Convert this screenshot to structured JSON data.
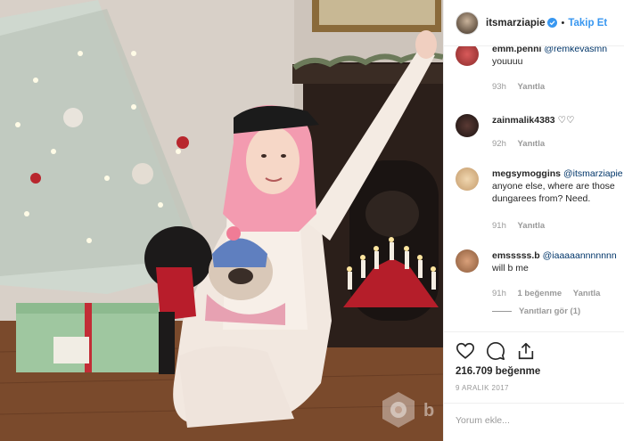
{
  "post": {
    "username": "itsmarziapie",
    "separator": "•",
    "follow_label": "Takip Et"
  },
  "comments": [
    {
      "username": "emm.penni",
      "mention": "@remkevasmn",
      "text": "youuuu",
      "time": "93h",
      "reply_label": "Yanıtla"
    },
    {
      "username": "zainmalik4383",
      "mention": "",
      "text": "♡♡",
      "time": "92h",
      "reply_label": "Yanıtla"
    },
    {
      "username": "megsymoggins",
      "mention": "@itsmarziapie",
      "text": "anyone else, where are those dungarees from? Need.",
      "time": "91h",
      "reply_label": "Yanıtla"
    },
    {
      "username": "emsssss.b",
      "mention": "@iaaaaannnnnnn",
      "text": "will b me",
      "time": "91h",
      "likes_label": "1 beğenme",
      "reply_label": "Yanıtla",
      "view_replies": "Yanıtları gör (1)"
    }
  ],
  "actions": {
    "likes": "216.709 beğenme",
    "date": "9 ARALIK 2017"
  },
  "add_comment": {
    "placeholder": "Yorum ekle..."
  },
  "watermark": {
    "text": "b"
  },
  "icons": {
    "like": "heart-icon",
    "comment": "comment-icon",
    "share": "share-icon",
    "verified": "verified-badge-icon"
  },
  "colors": {
    "link": "#3897f0",
    "text": "#262626",
    "muted": "#999999"
  }
}
